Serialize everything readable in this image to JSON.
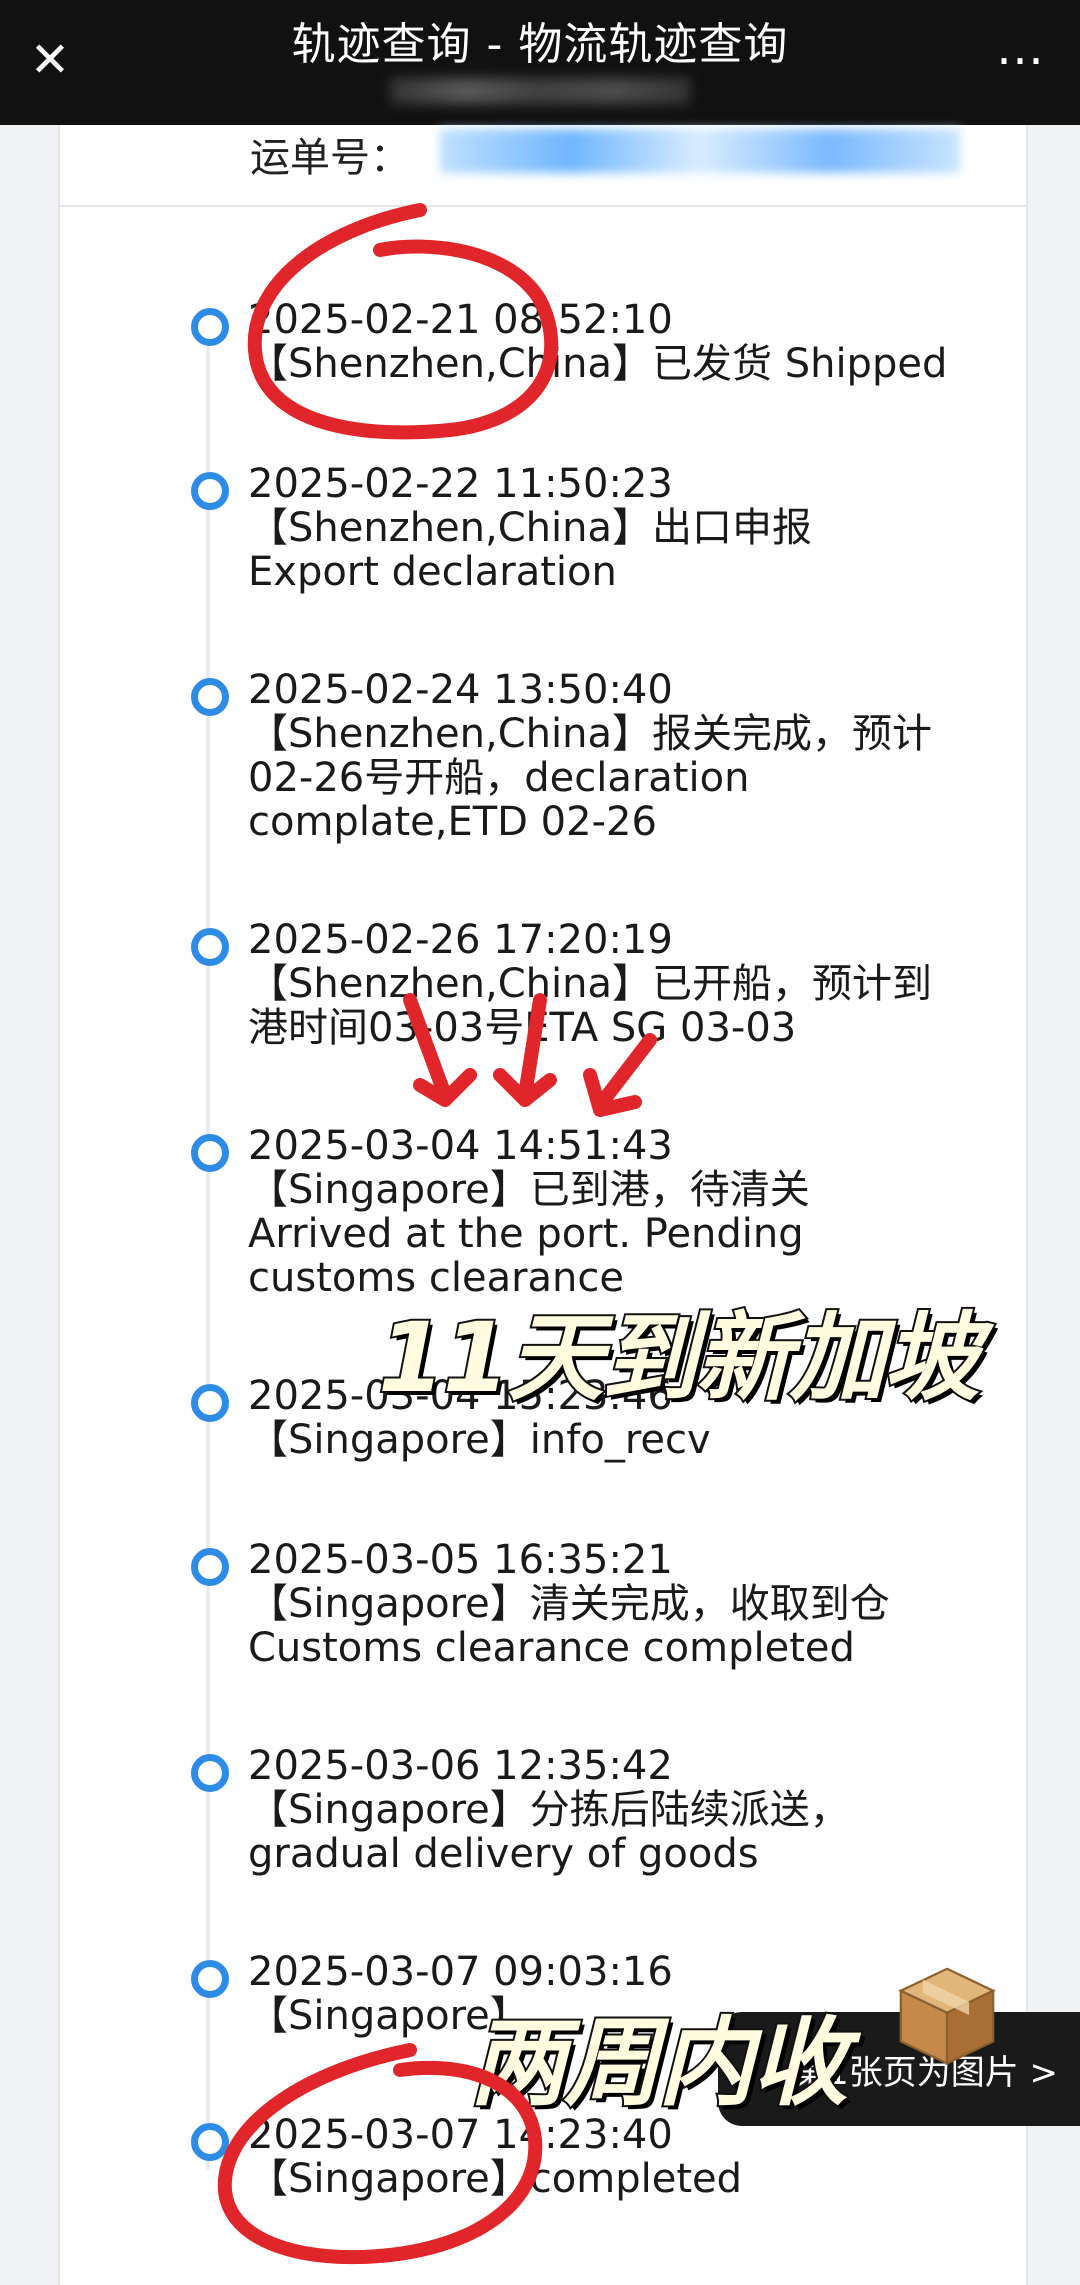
{
  "app": {
    "title": "轨迹查询 - 物流轨迹查询",
    "close_icon": "close-icon",
    "more_icon": "more-icon"
  },
  "waybill": {
    "label": "运单号："
  },
  "events": [
    {
      "time": "2025-02-21 08:52:10",
      "desc": "【Shenzhen,China】已发货 Shipped"
    },
    {
      "time": "2025-02-22 11:50:23",
      "desc": "【Shenzhen,China】出口申报\nExport declaration"
    },
    {
      "time": "2025-02-24 13:50:40",
      "desc": "【Shenzhen,China】报关完成，预计\n02-26号开船，declaration\ncomplate,ETD 02-26"
    },
    {
      "time": "2025-02-26 17:20:19",
      "desc": "【Shenzhen,China】已开船，预计到\n港时间03-03号ETA SG 03-03"
    },
    {
      "time": "2025-03-04 14:51:43",
      "desc": "【Singapore】已到港，待清关\nArrived at the port. Pending\ncustoms clearance"
    },
    {
      "time": "2025-03-04 15:23:46",
      "desc": "【Singapore】info_recv"
    },
    {
      "time": "2025-03-05 16:35:21",
      "desc": "【Singapore】清关完成，收取到仓\nCustoms clearance completed"
    },
    {
      "time": "2025-03-06 12:35:42",
      "desc": "【Singapore】分拣后陆续派送，\ngradual delivery of goods"
    },
    {
      "time": "2025-03-07 09:03:16",
      "desc": "【Singapore】"
    },
    {
      "time": "2025-03-07 14:23:40",
      "desc": "【Singapore】completed"
    }
  ],
  "overlays": {
    "eleven_days": "11天到新加坡",
    "two_weeks": "两周内收"
  },
  "floating_button": {
    "label": "第1张页为图片 >"
  },
  "colors": {
    "accent": "#2e8be6",
    "annotation": "#e0262a"
  }
}
